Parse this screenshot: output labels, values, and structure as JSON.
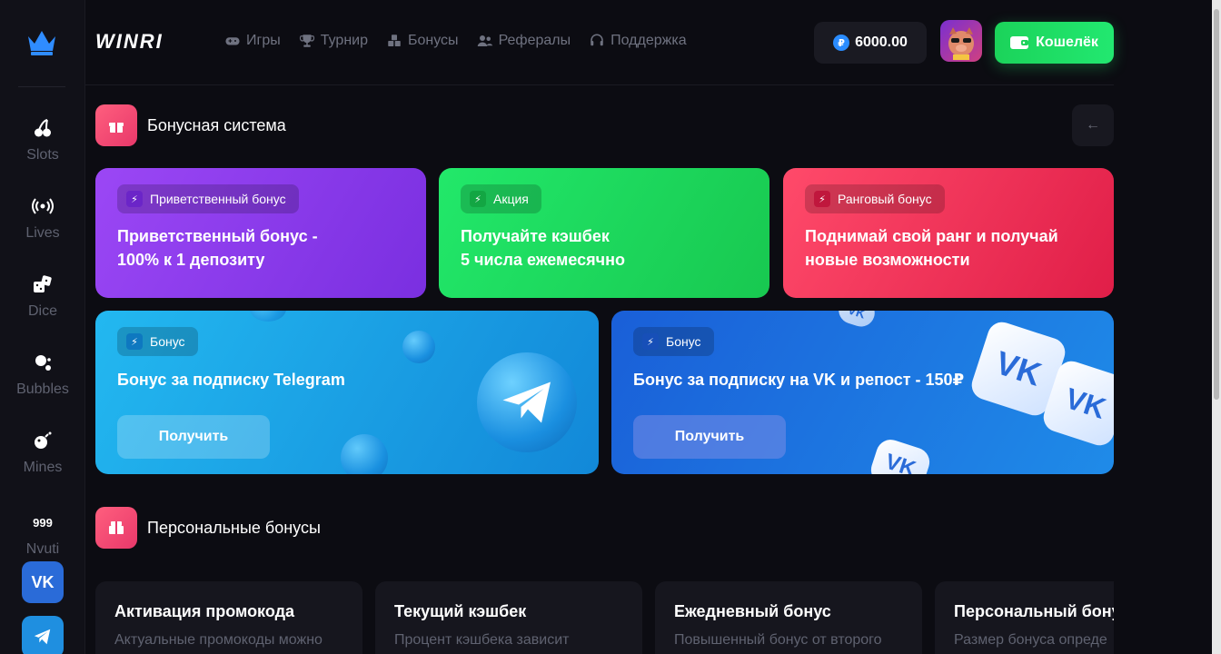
{
  "sidebar": {
    "items": [
      {
        "label": "Slots",
        "icon": "cherries-icon"
      },
      {
        "label": "Lives",
        "icon": "broadcast-icon"
      },
      {
        "label": "Dice",
        "icon": "dice-icon"
      },
      {
        "label": "Bubbles",
        "icon": "bubbles-icon"
      },
      {
        "label": "Mines",
        "icon": "bomb-icon"
      },
      {
        "label": "Nvuti",
        "icon": "999"
      }
    ],
    "socials": [
      {
        "label": "VK",
        "icon": "vk-icon",
        "color": "#2a6bd8"
      },
      {
        "label": "Telegram",
        "icon": "telegram-icon",
        "color": "#1f8fe0"
      }
    ]
  },
  "header": {
    "brand": "WINRI",
    "nav": [
      {
        "label": "Игры",
        "icon": "gamepad-icon"
      },
      {
        "label": "Турнир",
        "icon": "trophy-icon"
      },
      {
        "label": "Бонусы",
        "icon": "boxes-icon"
      },
      {
        "label": "Рефералы",
        "icon": "users-icon"
      },
      {
        "label": "Поддержка",
        "icon": "headset-icon"
      }
    ],
    "balance": "6000.00",
    "coin_symbol": "₽",
    "wallet_label": "Кошелёк"
  },
  "bonus_section": {
    "title": "Бонусная система",
    "back_icon": "←",
    "top_cards": [
      {
        "tag": "Приветственный бонус",
        "line1": "Приветственный бонус -",
        "line2": "100% к 1 депозиту",
        "color": "#8a3cf0"
      },
      {
        "tag": "Акция",
        "line1": "Получайте кэшбек",
        "line2": "5 числа ежемесячно",
        "color": "#1ed65a"
      },
      {
        "tag": "Ранговый бонус",
        "line1": "Поднимай свой ранг и получай",
        "line2": "новые возможности",
        "color": "#ef2d55"
      }
    ],
    "wide_cards": [
      {
        "tag": "Бонус",
        "title": "Бонус за подписку Telegram",
        "button": "Получить",
        "color": "#1aa3e6"
      },
      {
        "tag": "Бонус",
        "title": "Бонус за подписку на VK и репост - 150₽",
        "button": "Получить",
        "color": "#1f6fe0"
      }
    ]
  },
  "personal_section": {
    "title": "Персональные бонусы",
    "cards": [
      {
        "title": "Активация промокода",
        "desc": "Актуальные промокоды можно"
      },
      {
        "title": "Текущий кэшбек",
        "desc": "Процент кэшбека зависит"
      },
      {
        "title": "Ежедневный бонус",
        "desc": "Повышенный бонус от второго"
      },
      {
        "title": "Персональный бонус",
        "desc": "Размер бонуса опреде"
      }
    ]
  }
}
